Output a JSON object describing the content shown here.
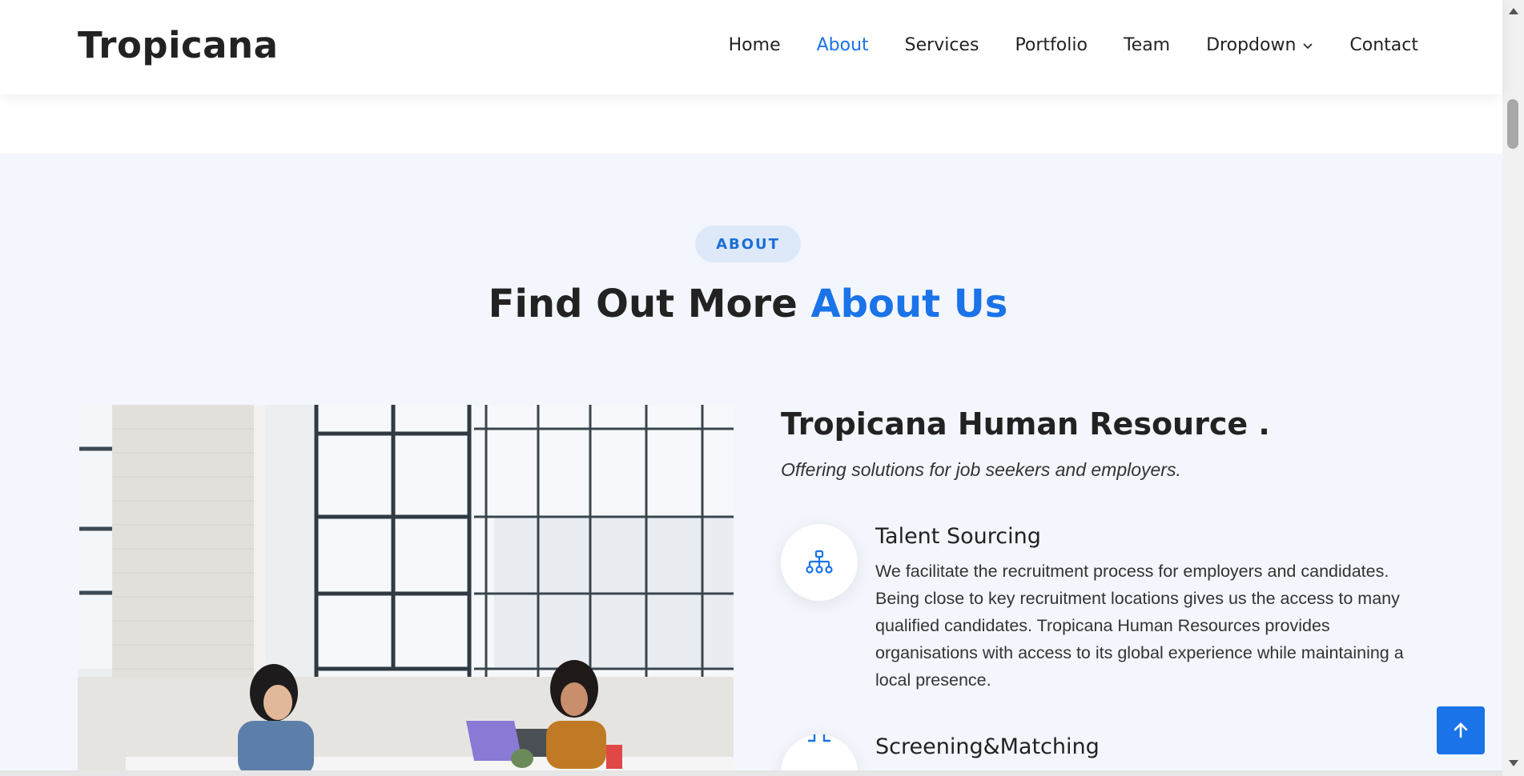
{
  "header": {
    "logo": "Tropicana",
    "nav": [
      {
        "label": "Home",
        "active": false
      },
      {
        "label": "About",
        "active": true
      },
      {
        "label": "Services",
        "active": false
      },
      {
        "label": "Portfolio",
        "active": false
      },
      {
        "label": "Team",
        "active": false
      },
      {
        "label": "Dropdown",
        "active": false
      },
      {
        "label": "Contact",
        "active": false
      }
    ]
  },
  "about": {
    "badge": "ABOUT",
    "title_plain": "Find Out More",
    "title_highlight": "About Us",
    "heading": "Tropicana Human Resource .",
    "subheading": "Offering solutions for job seekers and employers.",
    "features": [
      {
        "icon": "diagram-3-icon",
        "title": "Talent Sourcing",
        "text": "We facilitate the recruitment process for employers and candidates. Being close to key recruitment locations gives us the access to many qualified candidates. Tropicana Human Resources provides organisations with access to its global experience while maintaining a local presence."
      },
      {
        "icon": "fullscreen-exit-icon",
        "title": "Screening&Matching",
        "text": ""
      }
    ]
  },
  "colors": {
    "accent": "#1a73e8",
    "section_bg": "#f3f6fc",
    "badge_bg": "#dde9f8"
  }
}
